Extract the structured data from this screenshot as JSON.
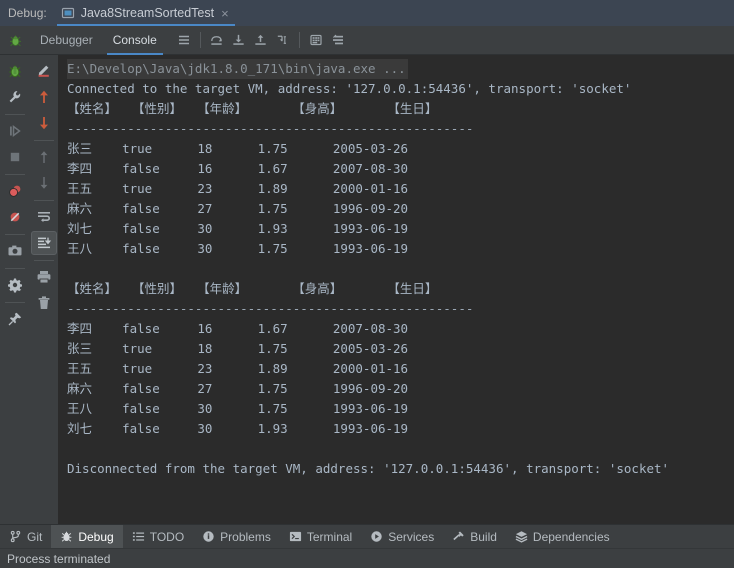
{
  "topbar": {
    "label": "Debug:",
    "session_tab": {
      "icon": "run-configuration-icon",
      "name": "Java8StreamSortedTest",
      "close": "×"
    }
  },
  "toolbar": {
    "gutter_icon": "debug-bug-icon",
    "tabs": [
      {
        "label": "Debugger",
        "active": false
      },
      {
        "label": "Console",
        "active": true
      }
    ],
    "buttons": [
      {
        "name": "frames-icon"
      },
      {
        "name": "step-over-icon"
      },
      {
        "name": "step-into-icon"
      },
      {
        "name": "step-out-icon"
      },
      {
        "name": "run-to-cursor-icon"
      },
      {
        "name": "evaluate-expression-icon"
      },
      {
        "name": "mute-breakpoints-icon"
      }
    ]
  },
  "left_rail": {
    "items": [
      {
        "name": "debug-bug-icon",
        "selected": false
      },
      {
        "name": "settings-wrench-icon",
        "selected": false
      },
      {
        "name": "resume-program-icon",
        "selected": false
      },
      {
        "name": "stop-program-icon",
        "selected": false
      },
      {
        "name": "view-breakpoints-icon",
        "selected": false
      },
      {
        "name": "mute-breakpoints-icon",
        "selected": false
      },
      {
        "name": "screenshot-camera-icon",
        "selected": false
      },
      {
        "name": "settings-gear-icon",
        "selected": false
      },
      {
        "name": "pin-tab-icon",
        "selected": false
      }
    ]
  },
  "console_rail": {
    "items": [
      {
        "name": "edit-pencil-icon",
        "selected": false
      },
      {
        "name": "up-arrow-red-icon",
        "selected": false
      },
      {
        "name": "down-arrow-red-icon",
        "selected": false
      },
      {
        "name": "up-arrow-gray-icon",
        "selected": false
      },
      {
        "name": "down-arrow-gray-icon",
        "selected": false
      },
      {
        "name": "soft-wrap-icon",
        "selected": false
      },
      {
        "name": "scroll-to-end-icon",
        "selected": true
      },
      {
        "name": "print-icon",
        "selected": false
      },
      {
        "name": "clear-all-trash-icon",
        "selected": false
      }
    ]
  },
  "console": {
    "lines": [
      {
        "kind": "cmd",
        "text": "E:\\Develop\\Java\\jdk1.8.0_171\\bin\\java.exe ..."
      },
      {
        "kind": "sys",
        "text": "Connected to the target VM, address: '127.0.0.1:54436', transport: 'socket'"
      },
      {
        "kind": "sys",
        "text": "【姓名】  【性别】  【年龄】      【身高】      【生日】"
      },
      {
        "kind": "dash",
        "text": "------------------------------------------------------"
      },
      {
        "kind": "sys",
        "text": "张三    true      18      1.75      2005-03-26"
      },
      {
        "kind": "sys",
        "text": "李四    false     16      1.67      2007-08-30"
      },
      {
        "kind": "sys",
        "text": "王五    true      23      1.89      2000-01-16"
      },
      {
        "kind": "sys",
        "text": "麻六    false     27      1.75      1996-09-20"
      },
      {
        "kind": "sys",
        "text": "刘七    false     30      1.93      1993-06-19"
      },
      {
        "kind": "sys",
        "text": "王八    false     30      1.75      1993-06-19"
      },
      {
        "kind": "blank",
        "text": " "
      },
      {
        "kind": "sys",
        "text": "【姓名】  【性别】  【年龄】      【身高】      【生日】"
      },
      {
        "kind": "dash",
        "text": "------------------------------------------------------"
      },
      {
        "kind": "sys",
        "text": "李四    false     16      1.67      2007-08-30"
      },
      {
        "kind": "sys",
        "text": "张三    true      18      1.75      2005-03-26"
      },
      {
        "kind": "sys",
        "text": "王五    true      23      1.89      2000-01-16"
      },
      {
        "kind": "sys",
        "text": "麻六    false     27      1.75      1996-09-20"
      },
      {
        "kind": "sys",
        "text": "王八    false     30      1.75      1993-06-19"
      },
      {
        "kind": "sys",
        "text": "刘七    false     30      1.93      1993-06-19"
      },
      {
        "kind": "blank",
        "text": " "
      },
      {
        "kind": "sys",
        "text": "Disconnected from the target VM, address: '127.0.0.1:54436', transport: 'socket'"
      }
    ]
  },
  "bottombar": {
    "items": [
      {
        "label": "Git",
        "icon": "git-branch-icon",
        "active": false
      },
      {
        "label": "Debug",
        "icon": "debug-bug-icon",
        "active": true
      },
      {
        "label": "TODO",
        "icon": "todo-list-icon",
        "active": false
      },
      {
        "label": "Problems",
        "icon": "problems-warning-icon",
        "active": false
      },
      {
        "label": "Terminal",
        "icon": "terminal-prompt-icon",
        "active": false
      },
      {
        "label": "Services",
        "icon": "services-play-icon",
        "active": false
      },
      {
        "label": "Build",
        "icon": "build-hammer-icon",
        "active": false
      },
      {
        "label": "Dependencies",
        "icon": "dependencies-layers-icon",
        "active": false
      }
    ]
  },
  "statusbar": {
    "text": "Process terminated"
  },
  "colors": {
    "topbar_bg": "#3c4552",
    "toolbar_bg": "#3c3f41",
    "console_bg": "#2b2b2b",
    "console_fg": "#a9b7c6",
    "accent": "#4a88c7",
    "selected_bg": "#4e5254",
    "red_arrow": "#cc5c3c",
    "green_bug": "#5a9e3f"
  }
}
